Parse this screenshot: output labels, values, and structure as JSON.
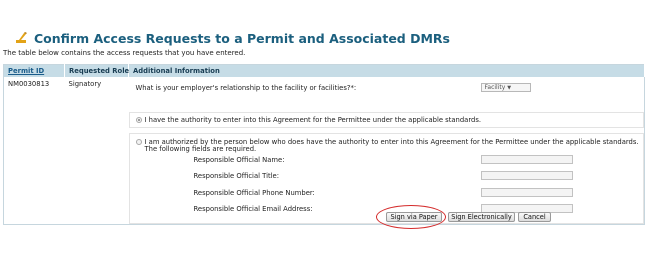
{
  "header": {
    "title": "Confirm Access Requests to a Permit and Associated DMRs",
    "subtitle": "The table below contains the access requests that you have entered."
  },
  "table": {
    "columns": [
      "Permit ID",
      "Requested Role",
      "Additional Information"
    ],
    "row": {
      "permit_id": "NM0030813",
      "role": "Signatory",
      "question": "What is your employer's relationship to the facility or facilities?*:",
      "select_value": "Facility",
      "option1": "I have the authority to enter into this Agreement for the Permittee under the applicable standards.",
      "option1_selected": true,
      "option2_line1": "I am authorized by the person below who does have the authority to enter into this Agreement for the Permittee under the applicable standards.",
      "option2_line2": "The following fields are required.",
      "option2_selected": false,
      "fields": [
        {
          "label": "Responsible Official Name:",
          "value": ""
        },
        {
          "label": "Responsible Official Title:",
          "value": ""
        },
        {
          "label": "Responsible Official Phone Number:",
          "value": ""
        },
        {
          "label": "Responsible Official Email Address:",
          "value": ""
        }
      ]
    }
  },
  "buttons": {
    "sign_paper": "Sign via Paper",
    "sign_electronic": "Sign Electronically",
    "cancel": "Cancel"
  },
  "colors": {
    "title": "#1b5f7e",
    "header_bg": "#c6dce6",
    "annotation": "#d42b2b"
  },
  "icons": {
    "title_icon": "signature-pen-icon",
    "select_arrow": "chevron-down-icon"
  }
}
